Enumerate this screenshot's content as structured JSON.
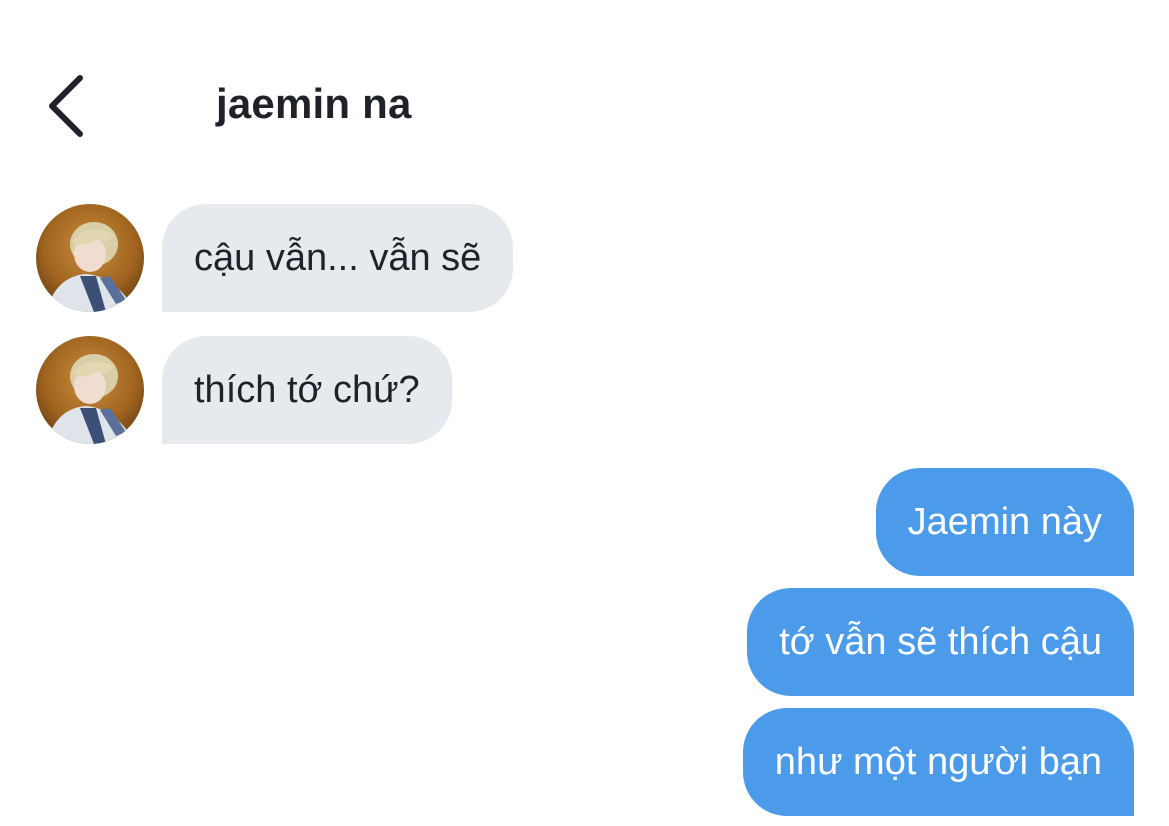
{
  "header": {
    "back_icon": "chevron-left-icon",
    "title": "jaemin na"
  },
  "colors": {
    "incoming_bubble": "#e6eaee",
    "outgoing_bubble": "#4c9bea",
    "outgoing_text": "#ffffff",
    "text": "#1f2329"
  },
  "messages": [
    {
      "direction": "incoming",
      "text": "cậu vẫn... vẫn sẽ"
    },
    {
      "direction": "incoming",
      "text": "thích tớ chứ?"
    },
    {
      "direction": "outgoing",
      "text": "Jaemin này"
    },
    {
      "direction": "outgoing",
      "text": "tớ vẫn sẽ thích cậu"
    },
    {
      "direction": "outgoing",
      "text": "như một người bạn"
    }
  ]
}
